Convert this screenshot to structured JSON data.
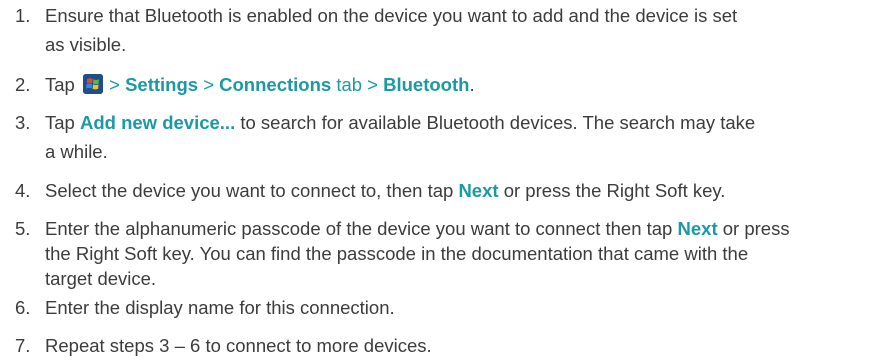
{
  "steps": [
    {
      "number": "1.",
      "line1": "Ensure that Bluetooth is enabled on the device you want to add and the device is set",
      "line2": "as visible."
    },
    {
      "number": "2.",
      "tap": "Tap",
      "sep1": ">",
      "settings": "Settings",
      "sep2": ">",
      "connections": "Connections",
      "tab": "tab",
      "sep3": ">",
      "bluetooth": "Bluetooth",
      "end": ".",
      "icon": "windows-start-icon"
    },
    {
      "number": "3.",
      "tap": "Tap",
      "action": "Add new device...",
      "rest1": "to search for available Bluetooth devices. The search may take",
      "line2": "a while."
    },
    {
      "number": "4.",
      "pre": "Select the device you want to connect to, then tap",
      "next": "Next",
      "post": "or press the Right Soft key."
    },
    {
      "number": "5.",
      "pre": "Enter the alphanumeric passcode of the device you want to connect then tap",
      "next": "Next",
      "post": "or press",
      "line2": "the Right Soft key. You can find the passcode in the documentation that came with the",
      "line3": "target device."
    },
    {
      "number": "6.",
      "text": "Enter the display name for this connection."
    },
    {
      "number": "7.",
      "text": "Repeat steps 3 – 6 to connect to more devices."
    }
  ],
  "colors": {
    "text": "#3c3c3c",
    "link": "#1a9aa5"
  }
}
